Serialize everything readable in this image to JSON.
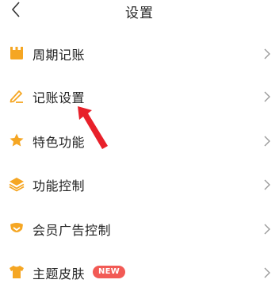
{
  "header": {
    "title": "设置",
    "back_icon": "chevron-left-icon"
  },
  "settings": {
    "items": [
      {
        "label": "周期记账",
        "icon": "calendar-icon"
      },
      {
        "label": "记账设置",
        "icon": "edit-pen-icon"
      },
      {
        "label": "特色功能",
        "icon": "star-icon"
      },
      {
        "label": "功能控制",
        "icon": "layers-icon"
      },
      {
        "label": "会员广告控制",
        "icon": "member-badge-icon"
      },
      {
        "label": "主题皮肤",
        "icon": "tshirt-icon",
        "badge": "NEW"
      }
    ]
  },
  "colors": {
    "icon_orange": "#f5a623",
    "badge_red": "#f25a55",
    "annotation_arrow": "#e8202a",
    "chevron": "#9a9a9a"
  }
}
